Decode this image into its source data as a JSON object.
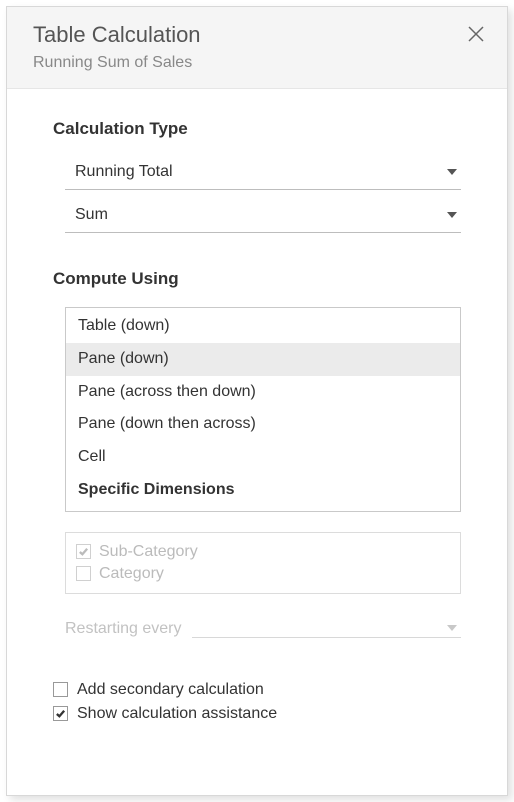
{
  "header": {
    "title": "Table Calculation",
    "subtitle": "Running Sum of Sales"
  },
  "calculation_type": {
    "label": "Calculation Type",
    "primary": "Running Total",
    "aggregation": "Sum"
  },
  "compute_using": {
    "label": "Compute Using",
    "options": [
      {
        "label": "Table (down)",
        "selected": false,
        "bold": false
      },
      {
        "label": "Pane (down)",
        "selected": true,
        "bold": false
      },
      {
        "label": "Pane (across then down)",
        "selected": false,
        "bold": false
      },
      {
        "label": "Pane (down then across)",
        "selected": false,
        "bold": false
      },
      {
        "label": "Cell",
        "selected": false,
        "bold": false
      },
      {
        "label": "Specific Dimensions",
        "selected": false,
        "bold": true
      }
    ]
  },
  "dimensions": {
    "items": [
      {
        "label": "Sub-Category",
        "checked": true,
        "disabled": true
      },
      {
        "label": "Category",
        "checked": false,
        "disabled": true
      }
    ]
  },
  "restarting": {
    "label": "Restarting every",
    "value": ""
  },
  "footer": {
    "secondary": {
      "label": "Add secondary calculation",
      "checked": false
    },
    "assistance": {
      "label": "Show calculation assistance",
      "checked": true
    }
  }
}
